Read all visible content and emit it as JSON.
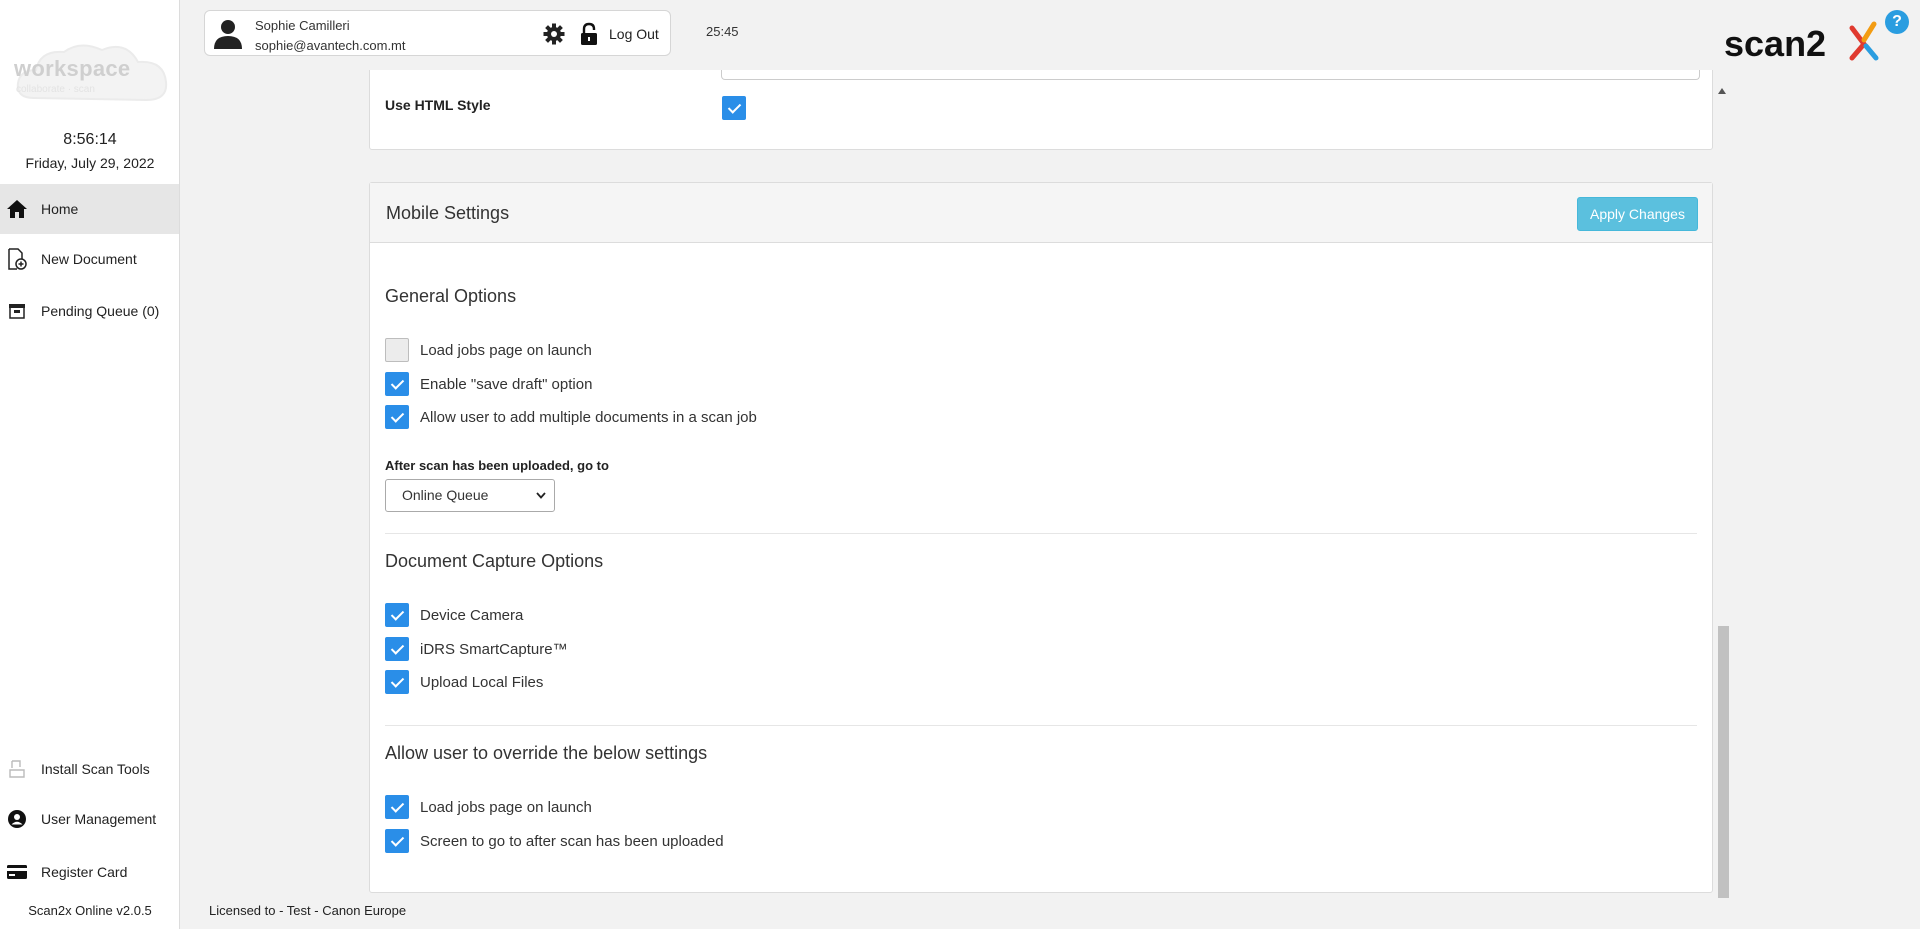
{
  "sidebar": {
    "logo_text": "workspace",
    "logo_sub": "collaborate · scan",
    "clock": "8:56:14",
    "date": "Friday, July 29, 2022",
    "nav": [
      {
        "label": "Home",
        "icon": "home-icon"
      },
      {
        "label": "New Document",
        "icon": "new-document-icon"
      },
      {
        "label": "Pending Queue (0)",
        "icon": "pending-queue-icon"
      }
    ],
    "bottom_nav": [
      {
        "label": "Install Scan Tools",
        "icon": "install-tools-icon"
      },
      {
        "label": "User Management",
        "icon": "user-management-icon"
      },
      {
        "label": "Register Card",
        "icon": "card-icon"
      }
    ],
    "version": "Scan2x Online v2.0.5"
  },
  "header": {
    "user_name": "Sophie Camilleri",
    "user_email": "sophie@avantech.com.mt",
    "logout_label": "Log Out",
    "session_timer": "25:45",
    "help_label": "?",
    "brand_text": "scan2"
  },
  "top_panel": {
    "html_style_label": "Use HTML Style",
    "html_style_checked": true
  },
  "mobile_settings": {
    "title": "Mobile Settings",
    "apply_label": "Apply Changes",
    "general": {
      "title": "General Options",
      "options": [
        {
          "label": "Load jobs page on launch",
          "checked": false
        },
        {
          "label": "Enable \"save draft\" option",
          "checked": true
        },
        {
          "label": "Allow user to add multiple documents in a scan job",
          "checked": true
        }
      ],
      "after_scan_label": "After scan has been uploaded, go to",
      "after_scan_value": "Online Queue"
    },
    "capture": {
      "title": "Document Capture Options",
      "options": [
        {
          "label": "Device Camera",
          "checked": true
        },
        {
          "label": "iDRS SmartCapture™",
          "checked": true
        },
        {
          "label": "Upload Local Files",
          "checked": true
        }
      ]
    },
    "override": {
      "title": "Allow user to override the below settings",
      "options": [
        {
          "label": "Load jobs page on launch",
          "checked": true
        },
        {
          "label": "Screen to go to after scan has been uploaded",
          "checked": true
        }
      ]
    }
  },
  "footer": {
    "licensed": "Licensed to - Test - Canon Europe"
  },
  "colors": {
    "checkbox_on": "#2a8ee8",
    "apply_button": "#5bc0de",
    "brand_red": "#e03a2f",
    "brand_orange": "#f39c12",
    "help_blue": "#2a9de0"
  }
}
